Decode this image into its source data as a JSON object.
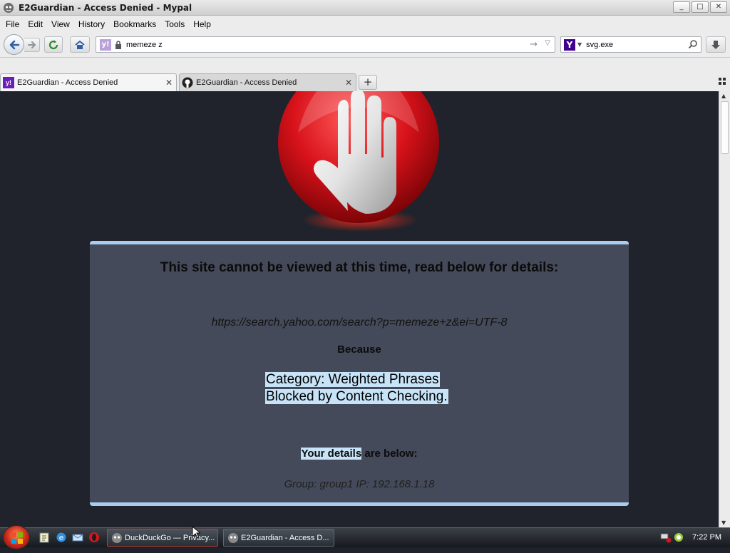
{
  "window": {
    "title": "E2Guardian - Access Denied - Mypal",
    "controls": {
      "minimize": "_",
      "maximize": "□",
      "close": "✕"
    }
  },
  "menu": [
    "File",
    "Edit",
    "View",
    "History",
    "Bookmarks",
    "Tools",
    "Help"
  ],
  "navbar": {
    "url_value": "memeze z",
    "search_value": "svg.exe",
    "search_engine": "Y"
  },
  "tabs": [
    {
      "label": "E2Guardian - Access Denied",
      "active": true,
      "icon": "yahoo-icon"
    },
    {
      "label": "E2Guardian - Access Denied",
      "active": false,
      "icon": "github-icon"
    }
  ],
  "page": {
    "heading": "This site cannot be viewed at this time, read below for details:",
    "blocked_url": "https://search.yahoo.com/search?p=memeze+z&ei=UTF-8",
    "because": "Because",
    "reason_line1": "Category: Weighted Phrases ",
    "reason_line2": "Blocked by Content Checking.",
    "details_highlight": "Your details",
    "details_rest": " are below:",
    "group_ip": "Group: group1   IP: 192.168.1.18"
  },
  "taskbar": {
    "windows": [
      {
        "label": "DuckDuckGo — Privacy..."
      },
      {
        "label": "E2Guardian - Access D..."
      }
    ],
    "clock": "7:22 PM"
  },
  "colors": {
    "page_background": "#20232b",
    "panel_background": "#444a59",
    "panel_border": "#a9cdef",
    "highlight": "#c7e3f7",
    "stop_red": "#d8121a"
  }
}
